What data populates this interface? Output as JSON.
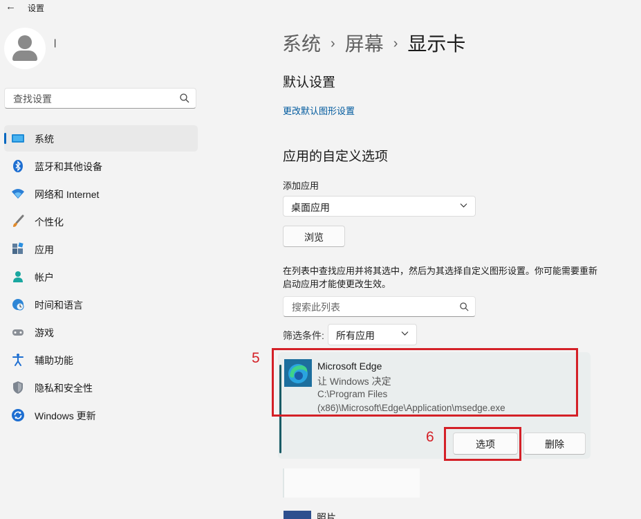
{
  "window": {
    "title": "设置"
  },
  "user": {
    "name": "|",
    "email": ""
  },
  "search": {
    "placeholder": "查找设置"
  },
  "sidebar": {
    "items": [
      {
        "label": "系统",
        "icon": "monitor-icon",
        "active": true
      },
      {
        "label": "蓝牙和其他设备",
        "icon": "bluetooth-icon"
      },
      {
        "label": "网络和 Internet",
        "icon": "wifi-icon"
      },
      {
        "label": "个性化",
        "icon": "brush-icon"
      },
      {
        "label": "应用",
        "icon": "apps-icon"
      },
      {
        "label": "帐户",
        "icon": "account-icon"
      },
      {
        "label": "时间和语言",
        "icon": "globe-clock-icon"
      },
      {
        "label": "游戏",
        "icon": "gamepad-icon"
      },
      {
        "label": "辅助功能",
        "icon": "accessibility-icon"
      },
      {
        "label": "隐私和安全性",
        "icon": "shield-icon"
      },
      {
        "label": "Windows 更新",
        "icon": "update-icon"
      }
    ]
  },
  "breadcrumb": {
    "part1": "系统",
    "part2": "屏幕",
    "current": "显示卡",
    "separator": "›"
  },
  "defaults": {
    "heading": "默认设置",
    "link": "更改默认图形设置"
  },
  "custom": {
    "heading": "应用的自定义选项",
    "add_app_label": "添加应用",
    "app_type_value": "桌面应用",
    "browse_label": "浏览",
    "description": "在列表中查找应用并将其选中，然后为其选择自定义图形设置。你可能需要重新启动应用才能使更改生效。",
    "list_search_placeholder": "搜索此列表",
    "filter_label": "筛选条件:",
    "filter_value": "所有应用"
  },
  "app_entry": {
    "name": "Microsoft Edge",
    "setting": "让 Windows 决定",
    "path": "C:\\Program Files (x86)\\Microsoft\\Edge\\Application\\msedge.exe",
    "options_label": "选项",
    "delete_label": "删除"
  },
  "annotations": {
    "step5": "5",
    "step6": "6",
    "color": "#d42027"
  },
  "next_app": {
    "name": "照片"
  },
  "colors": {
    "accent": "#0067c0",
    "link": "#005a9e",
    "card_accent": "#1a5c66"
  }
}
